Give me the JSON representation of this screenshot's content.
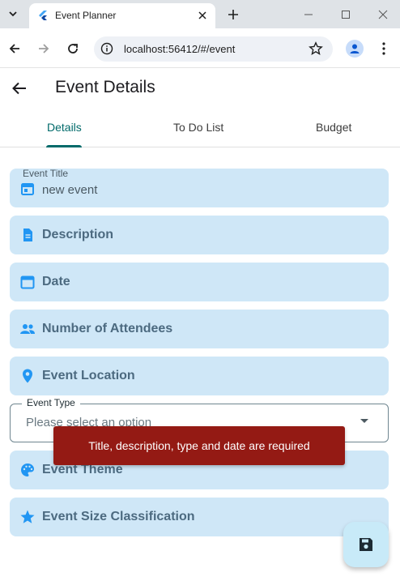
{
  "browser": {
    "tab_title": "Event Planner",
    "url": "localhost:56412/#/event"
  },
  "app_bar": {
    "title": "Event Details"
  },
  "tabs": [
    {
      "label": "Details",
      "active": true
    },
    {
      "label": "To Do List",
      "active": false
    },
    {
      "label": "Budget",
      "active": false
    }
  ],
  "form": {
    "event_title": {
      "label": "Event Title",
      "value": "new event",
      "icon": "calendar-icon"
    },
    "description": {
      "label": "Description",
      "icon": "description-icon"
    },
    "date": {
      "label": "Date",
      "icon": "calendar-icon"
    },
    "attendees": {
      "label": "Number of Attendees",
      "icon": "people-icon"
    },
    "location": {
      "label": "Event Location",
      "icon": "location-pin-icon"
    },
    "event_type": {
      "label": "Event Type",
      "placeholder": "Please select an option"
    },
    "theme": {
      "label": "Event Theme",
      "icon": "palette-icon"
    },
    "size": {
      "label": "Event Size Classification",
      "icon": "star-icon"
    }
  },
  "snackbar": {
    "message": "Title, description, type and date are required"
  },
  "fab": {
    "icon": "save-icon"
  },
  "colors": {
    "field_fill": "#cfe7f7",
    "icon_blue": "#2196f3",
    "accent_teal": "#006a6a",
    "snackbar_bg": "#941a14"
  }
}
